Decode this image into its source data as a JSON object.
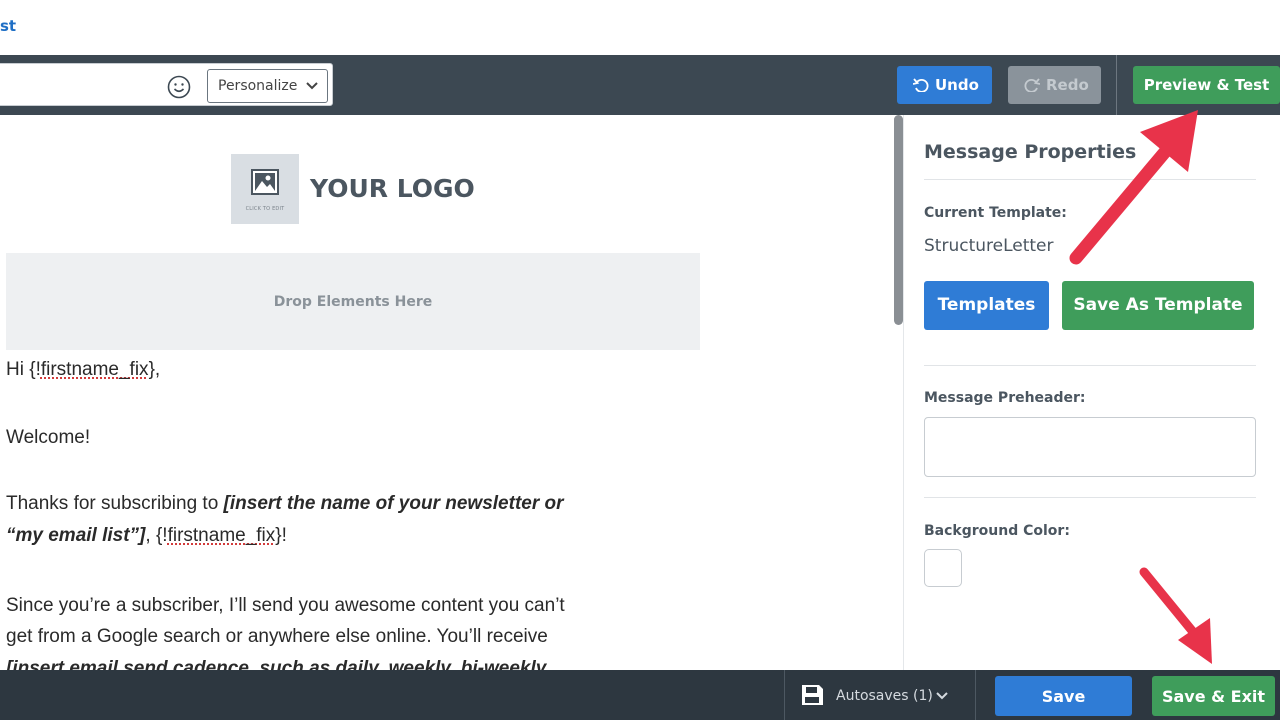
{
  "breadcrumb": {
    "text": "st"
  },
  "toolbar": {
    "personalize_label": "Personalize",
    "undo_label": "Undo",
    "redo_label": "Redo",
    "preview_label": "Preview & Test"
  },
  "canvas": {
    "logo_caption": "CLICK TO EDIT",
    "logo_text": "YOUR LOGO",
    "drop_zone_text": "Drop Elements Here",
    "greeting_prefix": "Hi {!",
    "merge_tag": "firstname_fix",
    "greeting_suffix": "},",
    "welcome": "Welcome!",
    "thanks_prefix": "Thanks for subscribing to ",
    "thanks_bold_1": "[insert the name of your newsletter or",
    "thanks_bold_2": "“my email list”]",
    "thanks_mid": ", {!",
    "thanks_suffix": "}!",
    "since_1": "Since you’re a subscriber, I’ll send you awesome content you can’t",
    "since_2": "get from a Google search or anywhere else online. You’ll receive",
    "since_3": "[insert email send cadence, such as daily, weekly, bi-weekly"
  },
  "panel": {
    "title": "Message Properties",
    "current_template_label": "Current Template:",
    "current_template_value": "StructureLetter",
    "templates_button": "Templates",
    "save_as_template_button": "Save As Template",
    "preheader_label": "Message Preheader:",
    "preheader_value": "",
    "background_color_label": "Background Color:",
    "background_color_value": "#ffffff"
  },
  "bottom_bar": {
    "autosaves_label": "Autosaves (1)",
    "save_label": "Save",
    "save_exit_label": "Save & Exit"
  },
  "colors": {
    "toolbar_bg": "#3c4852",
    "bottom_bar_bg": "#2d3740",
    "primary_blue": "#2f7cd6",
    "success_green": "#3f9d5b",
    "annotation_red": "#e8334a"
  },
  "icons": {
    "emoji": "smiley-icon",
    "undo": "undo-arrow-icon",
    "redo": "redo-arrow-icon",
    "logo_placeholder": "image-icon",
    "autosave": "floppy-disk-icon"
  }
}
